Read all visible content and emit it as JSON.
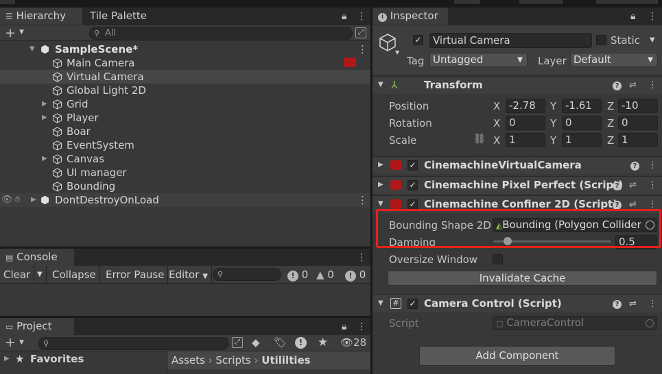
{
  "hierarchy": {
    "tabs": [
      "Hierarchy",
      "Tile Palette"
    ],
    "search_placeholder": "All",
    "scene": "SampleScene*",
    "items": [
      {
        "label": "Main Camera",
        "expandable": false
      },
      {
        "label": "Virtual Camera",
        "expandable": false,
        "selected": true
      },
      {
        "label": "Global Light 2D",
        "expandable": false
      },
      {
        "label": "Grid",
        "expandable": true
      },
      {
        "label": "Player",
        "expandable": true
      },
      {
        "label": "Boar",
        "expandable": false
      },
      {
        "label": "EventSystem",
        "expandable": false
      },
      {
        "label": "Canvas",
        "expandable": true
      },
      {
        "label": "UI manager",
        "expandable": false
      },
      {
        "label": "Bounding",
        "expandable": false
      }
    ],
    "ddol": "DontDestroyOnLoad"
  },
  "console": {
    "tab": "Console",
    "clear": "Clear",
    "collapse": "Collapse",
    "error_pause": "Error Pause",
    "editor": "Editor",
    "info_count": "0",
    "warn_count": "0",
    "error_count": "0"
  },
  "project": {
    "tab": "Project",
    "favorites": "Favorites",
    "hidden_count": "28",
    "breadcrumb": [
      "Assets",
      "Scripts",
      "Utililties"
    ]
  },
  "inspector": {
    "tab": "Inspector",
    "object_name": "Virtual Camera",
    "static_label": "Static",
    "tag_label": "Tag",
    "tag_value": "Untagged",
    "layer_label": "Layer",
    "layer_value": "Default",
    "transform": {
      "title": "Transform",
      "position_label": "Position",
      "rotation_label": "Rotation",
      "scale_label": "Scale",
      "position": {
        "x": "-2.78",
        "y": "-1.61",
        "z": "-10"
      },
      "rotation": {
        "x": "0",
        "y": "0",
        "z": "0"
      },
      "scale": {
        "x": "1",
        "y": "1",
        "z": "1"
      }
    },
    "vcam_title": "CinemachineVirtualCamera",
    "pixel_title": "Cinemachine Pixel Perfect (Script)",
    "confiner": {
      "title": "Cinemachine Confiner 2D (Script)",
      "shape_label": "Bounding Shape 2D",
      "shape_value": "Bounding (Polygon Collider",
      "damping_label": "Damping",
      "damping_value": "0.5",
      "damping_slider": 0.1,
      "oversize_label": "Oversize Window",
      "invalidate": "Invalidate Cache"
    },
    "camctrl": {
      "title": "Camera Control (Script)",
      "script_label": "Script",
      "script_value": "CameraControl"
    },
    "add_component": "Add Component"
  }
}
